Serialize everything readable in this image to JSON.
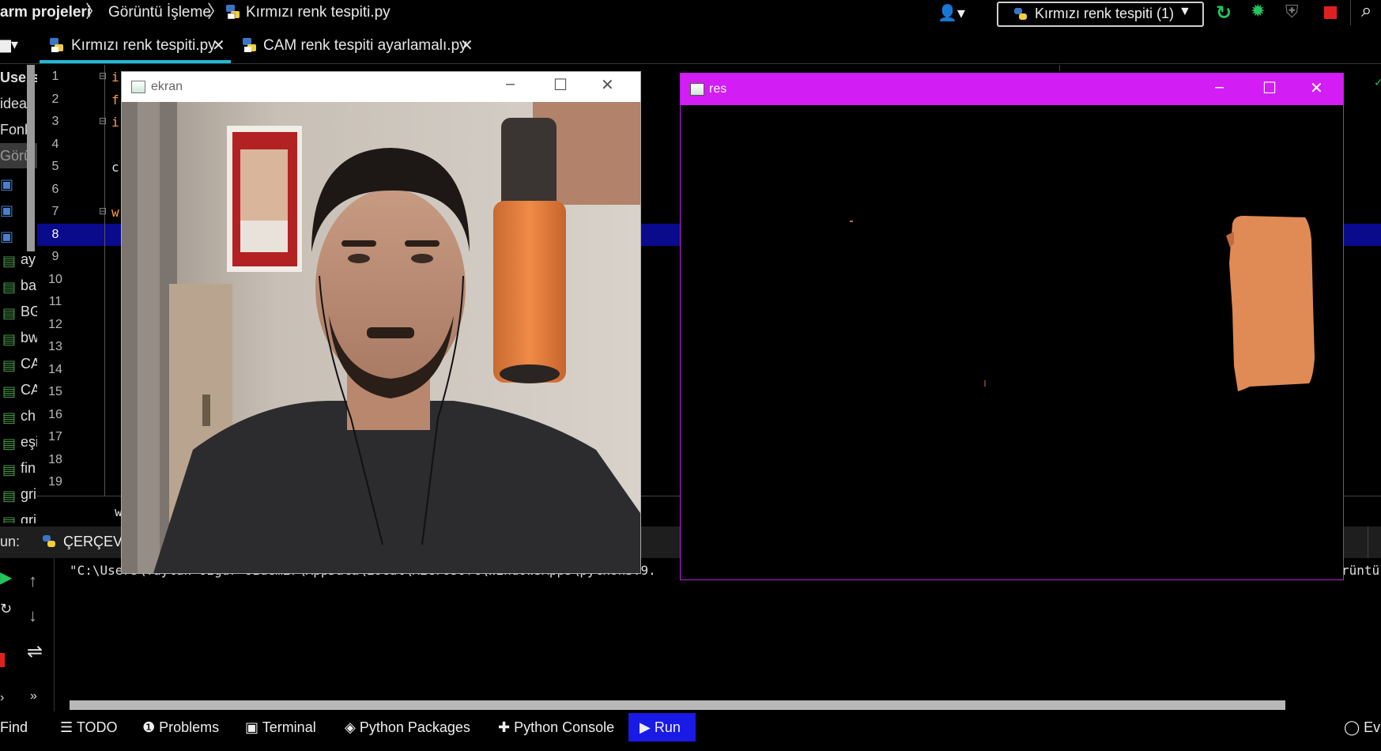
{
  "navbar": {
    "project": "arm projeleri",
    "folder": "Görüntü İşleme",
    "file": "Kırmızı renk tespiti.py",
    "run_config": "Kırmızı renk tespiti (1)"
  },
  "editor_tabs": [
    {
      "label": "Kırmızı renk tespiti.py",
      "active": true
    },
    {
      "label": "CAM renk tespiti ayarlamalı.py",
      "active": false
    }
  ],
  "project_tree": [
    "Users",
    "idea",
    "Fonk",
    "Görü",
    "",
    "",
    "",
    "ay",
    "ba",
    "BG",
    "bw",
    "CA",
    "CA",
    "ch",
    "eşi",
    "fin",
    "gri",
    "gri"
  ],
  "line_numbers": [
    "1",
    "2",
    "3",
    "4",
    "5",
    "6",
    "7",
    "8",
    "9",
    "10",
    "11",
    "12",
    "13",
    "14",
    "15",
    "16",
    "17",
    "18",
    "19"
  ],
  "code_fragments": {
    "line1": "i",
    "line2": "f",
    "line3": "i",
    "line5": "c",
    "line7": "w",
    "below": "w"
  },
  "windows": {
    "ekran": {
      "title": "ekran"
    },
    "res": {
      "title": "res"
    }
  },
  "run_panel": {
    "label": "un:",
    "config": "ÇERÇEVE",
    "command": "\"C:\\Users\\Taylan Özgür Özdemir\\AppData\\Local\\Microsoft\\WindowsApps\\python3.9.",
    "right_text": "rüntü"
  },
  "tool_windows": [
    "Find",
    "TODO",
    "Problems",
    "Terminal",
    "Python Packages",
    "Python Console",
    "Run",
    "Eve"
  ],
  "colors": {
    "accent_tab": "#1fb8d8",
    "res_titlebar": "#d21df4",
    "run_highlight": "#1a1ae6",
    "selected_line": "#0a0a8c",
    "orange_object": "#e08a55"
  }
}
